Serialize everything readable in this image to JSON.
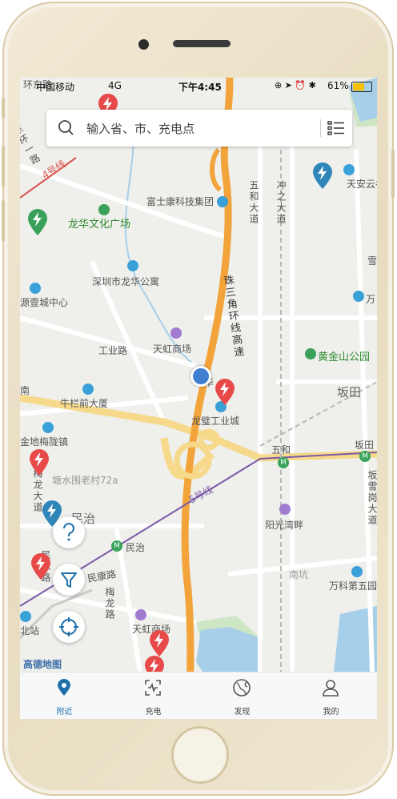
{
  "status_bar": {
    "carrier": "中国移动",
    "network": "4G",
    "time": "下午4:45",
    "battery": "61%"
  },
  "search": {
    "placeholder": "输入省、市、充电点"
  },
  "map": {
    "labels": {
      "fukang": "富士康科技集团",
      "longhua_culture": "龙华文化广场",
      "longhua_apartment": "深圳市龙华公寓",
      "yuanyicheng": "源壹城中心",
      "gongye_road": "工业路",
      "tianhong1": "天虹商场",
      "niulan": "牛栏前大厦",
      "jindi": "金地梅陇镇",
      "longbi": "龙璧工业城",
      "tangshuiwei": "塘水围老村72a",
      "minzhi_area": "民治",
      "minzhi_metro": "民治",
      "minkang": "民康路",
      "tianhong2": "天虹商场",
      "line5": "5号线",
      "wuhe_metro": "五和",
      "bantian_metro": "坂田",
      "bantian_area": "坂田",
      "yangguang": "阳光湾畔",
      "nankeng": "南坑",
      "vanke5": "万科第五园",
      "huangjinshan": "黄金山公园",
      "tianan": "天安云谷",
      "wanke_top": "万",
      "xue": "雪",
      "wuhe_avenue": "五和大道",
      "chongzhi": "冲之大道",
      "expressway": "珠三角环线高速",
      "meilong": "梅龙大道",
      "meilong_road": "梅龙路",
      "dongfeng": "东环一路",
      "bantian_xuegang": "坂雪岗大道",
      "north_station": "北站",
      "line4": "4号线",
      "nan": "南",
      "huachang": "华",
      "huanan": "环东路",
      "minle": "民乐路"
    }
  },
  "fabs": {
    "help": "help",
    "filter": "filter",
    "locate": "locate"
  },
  "brand": "高德地图",
  "tabs": [
    {
      "label": "附近",
      "icon": "location-pin-icon",
      "active": true
    },
    {
      "label": "充电",
      "icon": "charge-scan-icon",
      "active": false
    },
    {
      "label": "发现",
      "icon": "compass-globe-icon",
      "active": false
    },
    {
      "label": "我的",
      "icon": "user-icon",
      "active": false
    }
  ],
  "colors": {
    "accent": "#1f6fa9",
    "charger_red": "#e84a4a",
    "charger_green": "#3aa15a",
    "charger_blue": "#2f86b8",
    "expressway": "#f2a43a"
  }
}
